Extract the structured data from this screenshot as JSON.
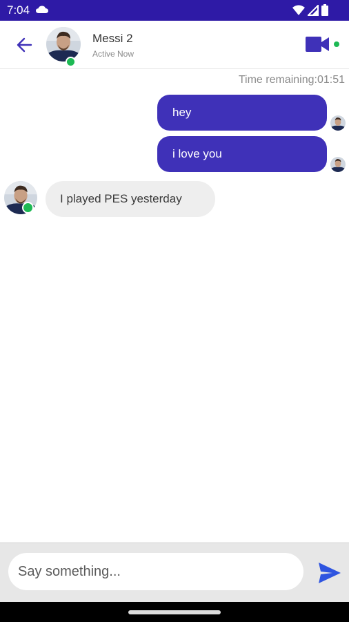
{
  "status_bar": {
    "time": "7:04"
  },
  "header": {
    "contact_name": "Messi 2",
    "contact_status": "Active Now",
    "back_icon": "arrow-back-icon",
    "video_icon": "video-call-icon"
  },
  "chat": {
    "timer_text": "Time remaining:01:51",
    "messages": [
      {
        "direction": "out",
        "text": "hey"
      },
      {
        "direction": "out",
        "text": "i love you"
      },
      {
        "direction": "in",
        "text": "I played PES yesterday"
      }
    ]
  },
  "composer": {
    "placeholder": "Say something...",
    "value": "",
    "send_icon": "send-icon"
  },
  "colors": {
    "accent": "#3f31b8",
    "status_bar": "#2e1aa6",
    "online": "#1db954"
  }
}
